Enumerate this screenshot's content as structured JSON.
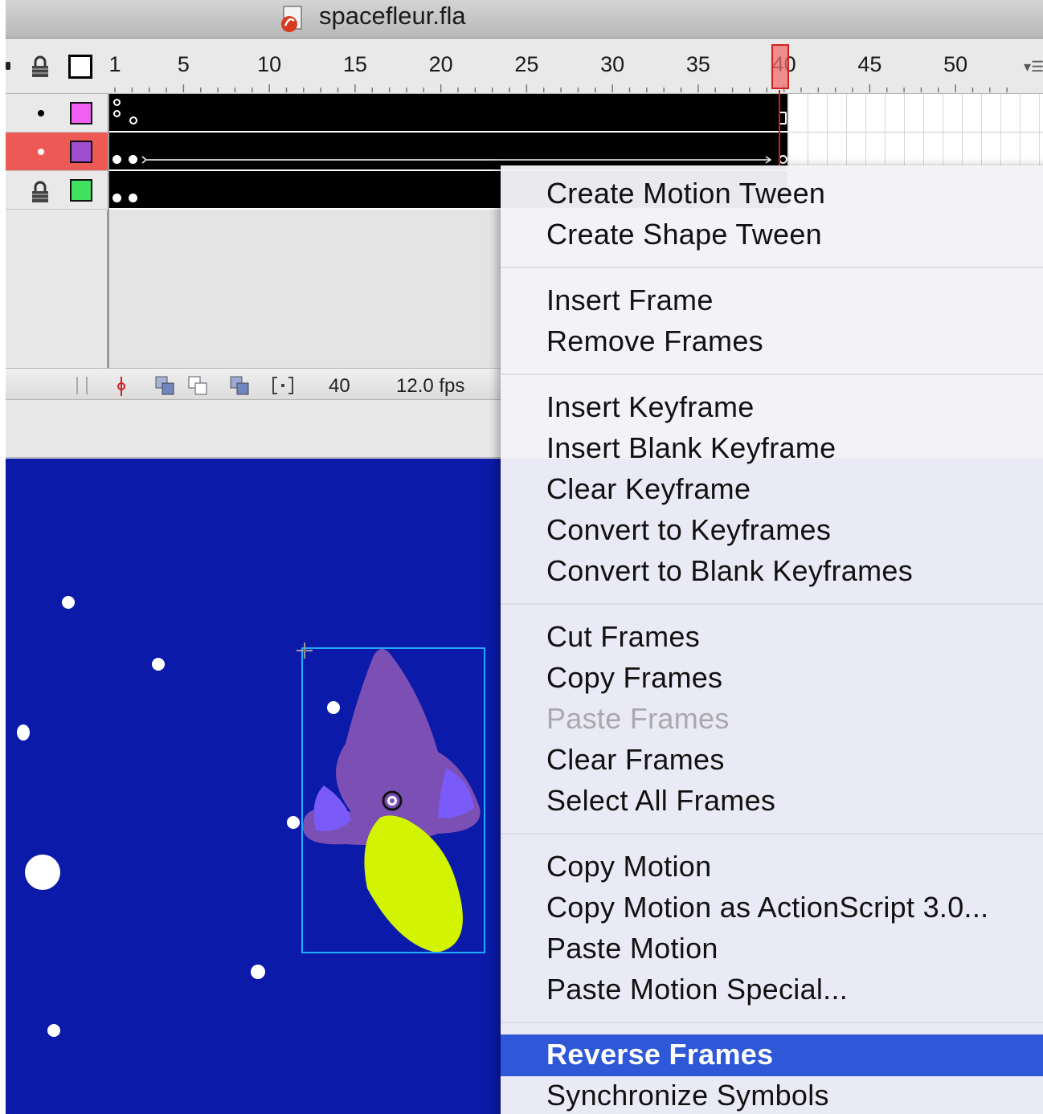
{
  "window": {
    "title": "spacefleur.fla"
  },
  "timeline": {
    "ruler_numbers": [
      "1",
      "5",
      "10",
      "15",
      "20",
      "25",
      "30",
      "35",
      "40",
      "45",
      "50"
    ],
    "current_frame": "40",
    "frame_rate": "12.0 fps",
    "layers": [
      {
        "swatch_color": "#f060f0",
        "state": "visible"
      },
      {
        "swatch_color": "#a04ed0",
        "state": "selected"
      },
      {
        "swatch_color": "#40e060",
        "state": "locked"
      }
    ]
  },
  "stage": {
    "background": "#0b1aa8"
  },
  "context_menu": {
    "groups": [
      [
        "Create Motion Tween",
        "Create Shape Tween"
      ],
      [
        "Insert Frame",
        "Remove Frames"
      ],
      [
        "Insert Keyframe",
        "Insert Blank Keyframe",
        "Clear Keyframe",
        "Convert to Keyframes",
        "Convert to Blank Keyframes"
      ],
      [
        "Cut Frames",
        "Copy Frames",
        "Paste Frames",
        "Clear Frames",
        "Select All Frames"
      ],
      [
        "Copy Motion",
        "Copy Motion as ActionScript 3.0...",
        "Paste Motion",
        "Paste Motion Special..."
      ],
      [
        "Reverse Frames",
        "Synchronize Symbols"
      ]
    ],
    "disabled": [
      "Paste Frames"
    ],
    "highlighted": "Reverse Frames",
    "highlight_color": "#2f58d8"
  }
}
